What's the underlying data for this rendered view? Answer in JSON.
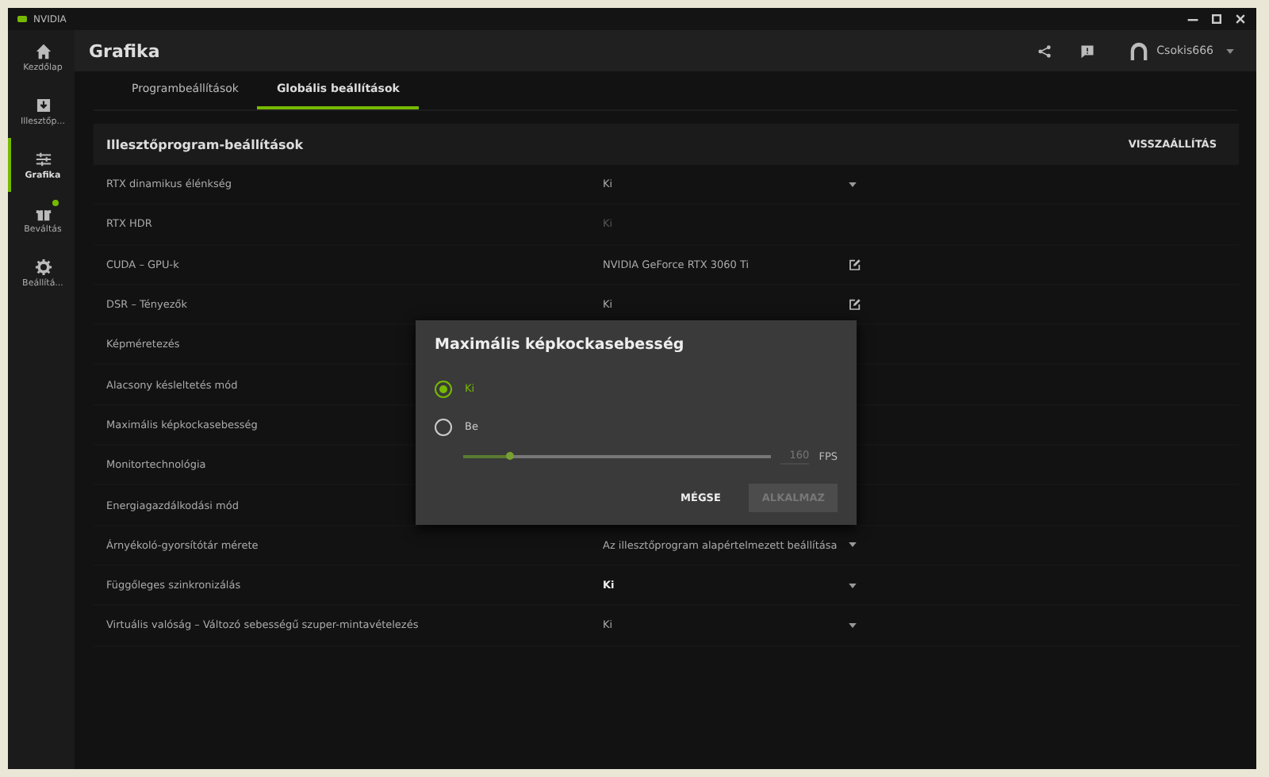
{
  "window": {
    "title": "NVIDIA"
  },
  "sidebar": {
    "items": [
      {
        "label": "Kezdőlap",
        "selected": false,
        "badge": false
      },
      {
        "label": "Illesztőp...",
        "selected": false,
        "badge": false
      },
      {
        "label": "Grafika",
        "selected": true,
        "badge": false
      },
      {
        "label": "Beváltás",
        "selected": false,
        "badge": true
      },
      {
        "label": "Beállítá...",
        "selected": false,
        "badge": false
      }
    ]
  },
  "header": {
    "title": "Grafika",
    "user": "Csokis666"
  },
  "tabs": [
    {
      "label": "Programbeállítások",
      "selected": false
    },
    {
      "label": "Globális beállítások",
      "selected": true
    }
  ],
  "section": {
    "title": "Illesztőprogram-beállítások",
    "reset": "VISSZAÁLLÍTÁS"
  },
  "settings": [
    {
      "label": "RTX dinamikus élénkség",
      "value": "Ki",
      "kind": "dropdown",
      "disabled": false,
      "modified": false
    },
    {
      "label": "RTX HDR",
      "value": "Ki",
      "kind": "plain",
      "disabled": true,
      "modified": false
    },
    {
      "label": "CUDA – GPU-k",
      "value": "NVIDIA GeForce RTX 3060 Ti",
      "kind": "edit",
      "disabled": false,
      "modified": false
    },
    {
      "label": "DSR – Tényezők",
      "value": "Ki",
      "kind": "edit",
      "disabled": false,
      "modified": false
    },
    {
      "label": "Képméretezés"
    },
    {
      "label": "Alacsony késleltetés mód"
    },
    {
      "label": "Maximális képkockasebesség"
    },
    {
      "label": "Monitortechnológia"
    },
    {
      "label": "Energiagazdálkodási mód"
    },
    {
      "label": "Árnyékoló-gyorsítótár mérete",
      "value": "Az illesztőprogram alapértelmezett beállítása",
      "kind": "dropdown",
      "disabled": false,
      "modified": false
    },
    {
      "label": "Függőleges szinkronizálás",
      "value": "Ki",
      "kind": "dropdown",
      "disabled": false,
      "modified": true
    },
    {
      "label": "Virtuális valóság – Változó sebességű szuper-mintavételezés",
      "value": "Ki",
      "kind": "dropdown",
      "disabled": false,
      "modified": false
    }
  ],
  "dialog": {
    "title": "Maximális képkockasebesség",
    "options": [
      {
        "label": "Ki",
        "selected": true
      },
      {
        "label": "Be",
        "selected": false
      }
    ],
    "slider": {
      "level": 0.15,
      "placeholder": "160",
      "unit": "FPS"
    },
    "buttons": [
      {
        "label": "MÉGSE",
        "disabled": false
      },
      {
        "label": "ALKALMAZ",
        "disabled": true
      }
    ]
  }
}
